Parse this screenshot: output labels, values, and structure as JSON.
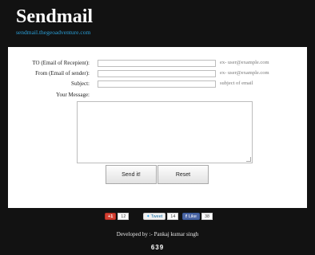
{
  "header": {
    "title": "Sendmail",
    "subtitle_link": "sendmail.thegeoadventure.com"
  },
  "form": {
    "to_label": "TO (Email of Recepient):",
    "to_value": "",
    "to_hint": "ex- user@example.com",
    "from_label": "From (Email of sender):",
    "from_value": "",
    "from_hint": "ex- user@example.com",
    "subject_label": "Subject:",
    "subject_value": "",
    "subject_hint": "subject of email",
    "message_label": "Your Message:",
    "message_value": "",
    "send_label": "Send it!",
    "reset_label": "Reset"
  },
  "social": {
    "gplus_label": "+1",
    "gplus_count": "12",
    "twitter_label": "Tweet",
    "twitter_count": "14",
    "facebook_label": "Like",
    "facebook_count": "38"
  },
  "footer": {
    "credit": "Developed by :- Pankaj kumar singh",
    "visit_counter": "639"
  }
}
